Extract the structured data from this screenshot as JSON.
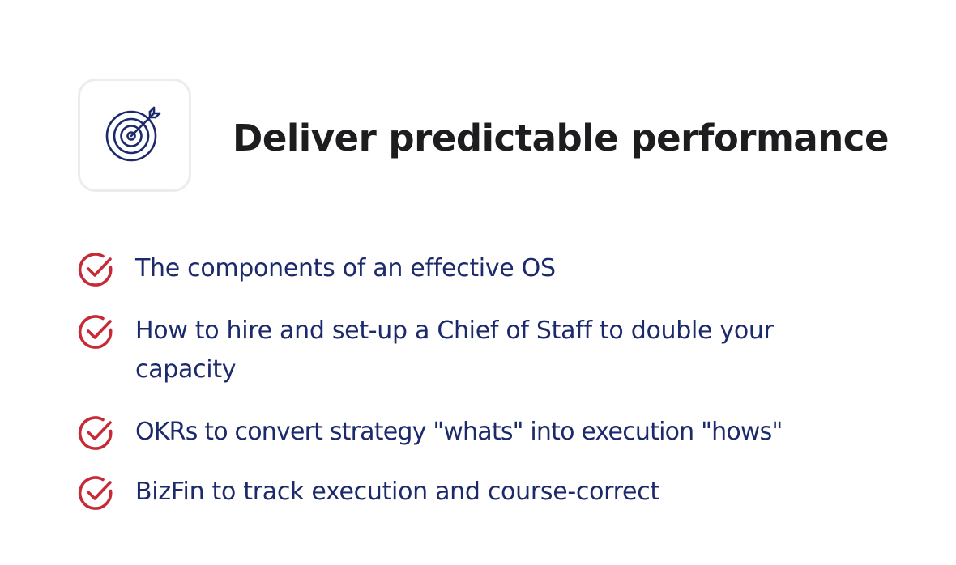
{
  "colors": {
    "heading": "#1d1d1f",
    "list_text": "#1c2a6b",
    "check_icon": "#c62a36",
    "target_icon": "#1c2a6b",
    "tile_border": "#ececef"
  },
  "header": {
    "icon": "target-icon",
    "title": "Deliver predictable performance"
  },
  "benefits": [
    {
      "icon": "check-circle-icon",
      "text": "The components of an effective OS"
    },
    {
      "icon": "check-circle-icon",
      "text": "How to hire and set-up a Chief of Staff to double your capacity"
    },
    {
      "icon": "check-circle-icon",
      "text": "OKRs to convert strategy \"whats\" into execution \"hows\""
    },
    {
      "icon": "check-circle-icon",
      "text": "BizFin to track execution and course-correct"
    }
  ]
}
